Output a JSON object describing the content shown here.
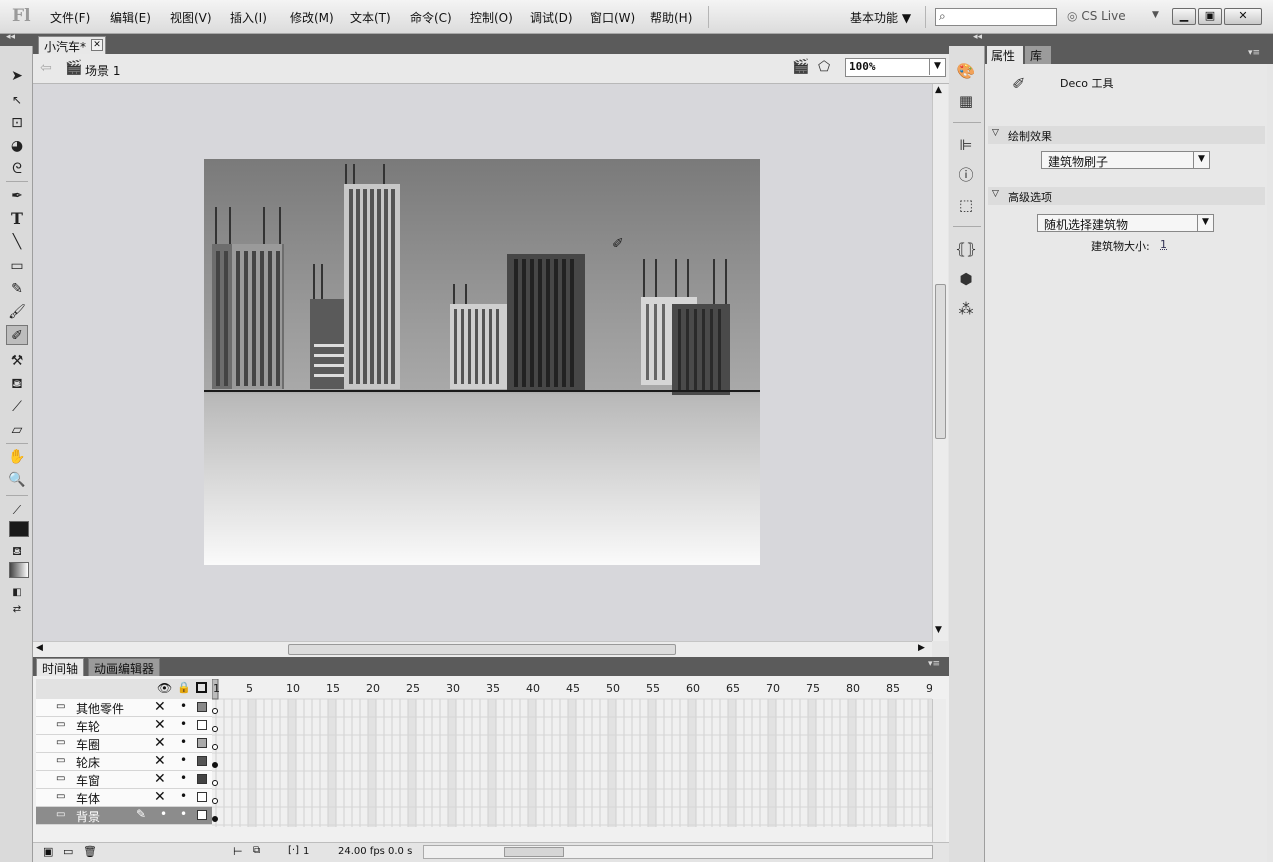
{
  "app": {
    "logo": "Fl"
  },
  "menu": [
    {
      "label": "文件(F)"
    },
    {
      "label": "编辑(E)"
    },
    {
      "label": "视图(V)"
    },
    {
      "label": "插入(I)"
    },
    {
      "label": "修改(M)"
    },
    {
      "label": "文本(T)"
    },
    {
      "label": "命令(C)"
    },
    {
      "label": "控制(O)"
    },
    {
      "label": "调试(D)"
    },
    {
      "label": "窗口(W)"
    },
    {
      "label": "帮助(H)"
    }
  ],
  "workspace": {
    "label": "基本功能 ▼"
  },
  "search": {
    "placeholder": ""
  },
  "cslive": "CS Live",
  "document": {
    "tab_label": "小汽车*",
    "scene_label": "场景 1",
    "zoom": "100%"
  },
  "timeline": {
    "tabs": [
      "时间轴",
      "动画编辑器"
    ],
    "frame_numbers": [
      "1",
      "5",
      "10",
      "15",
      "20",
      "25",
      "30",
      "35",
      "40",
      "45",
      "50",
      "55",
      "60",
      "65",
      "70",
      "75",
      "80",
      "85",
      "9"
    ],
    "layers": [
      {
        "name": "其他零件",
        "active": false
      },
      {
        "name": "车轮",
        "active": false
      },
      {
        "name": "车圈",
        "active": false
      },
      {
        "name": "轮床",
        "active": false
      },
      {
        "name": "车窗",
        "active": false
      },
      {
        "name": "车体",
        "active": false
      },
      {
        "name": "背景",
        "active": true
      }
    ],
    "current_frame": "1",
    "fps": "24.00 fps",
    "time": "0.0 s"
  },
  "properties": {
    "tabs": [
      "属性",
      "库"
    ],
    "tool_name": "Deco 工具",
    "section_draw": "绘制效果",
    "draw_effect": "建筑物刷子",
    "section_advanced": "高级选项",
    "advanced_option": "随机选择建筑物",
    "building_size_label": "建筑物大小:",
    "building_size_value": "1"
  },
  "colors": {
    "panel_dark": "#5b5b5b",
    "stage_bg": "#d7d7db",
    "layer_active": "#8c8c8c"
  }
}
